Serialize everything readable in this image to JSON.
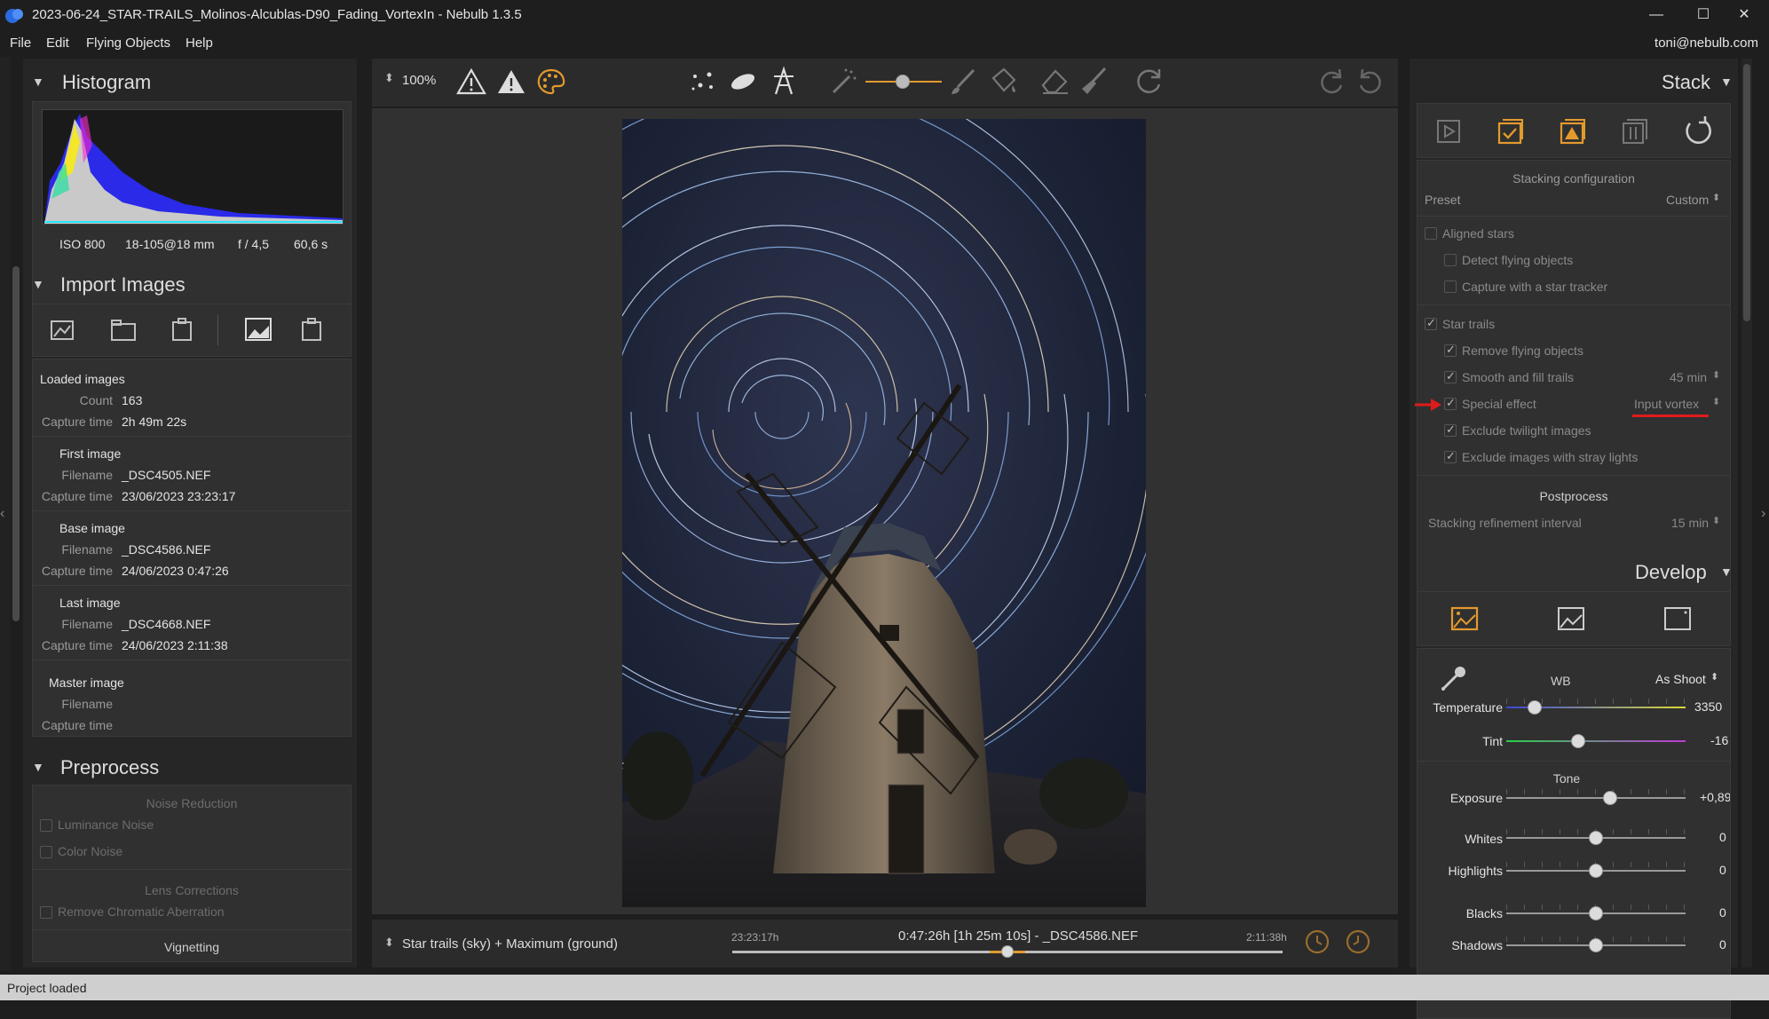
{
  "window": {
    "title": "2023-06-24_STAR-TRAILS_Molinos-Alcublas-D90_Fading_VortexIn - Nebulb 1.3.5",
    "minimize": "—",
    "maximize": "☐",
    "close": "✕"
  },
  "menu": {
    "items": [
      "File",
      "Edit",
      "Flying Objects",
      "Help"
    ],
    "user": "toni@nebulb.com"
  },
  "toolbar": {
    "zoom": "100%",
    "icons": [
      "warning-outline-icon",
      "warning-filled-icon",
      "palette-icon",
      "stars-icon",
      "comet-icon",
      "tower-icon",
      "magic-wand-icon",
      "brush-icon",
      "bucket-icon",
      "eraser-icon",
      "broom-icon",
      "refresh-icon",
      "redo-icon",
      "undo-icon"
    ],
    "accent": "#e39a2d"
  },
  "histogram": {
    "title": "Histogram",
    "iso": "ISO 800",
    "lens": "18-105@18 mm",
    "aperture": "f / 4,5",
    "exposure": "60,6 s"
  },
  "import": {
    "title": "Import Images",
    "loaded_title": "Loaded images",
    "count_label": "Count",
    "count": "163",
    "capture_label": "Capture time",
    "capture": "2h 49m 22s",
    "first": {
      "title": "First image",
      "filename_label": "Filename",
      "filename": "_DSC4505.NEF",
      "capture_label": "Capture time",
      "capture": "23/06/2023 23:23:17"
    },
    "base": {
      "title": "Base image",
      "filename_label": "Filename",
      "filename": "_DSC4586.NEF",
      "capture_label": "Capture time",
      "capture": "24/06/2023 0:47:26"
    },
    "last": {
      "title": "Last image",
      "filename_label": "Filename",
      "filename": "_DSC4668.NEF",
      "capture_label": "Capture time",
      "capture": "24/06/2023 2:11:38"
    },
    "master": {
      "title": "Master image",
      "filename_label": "Filename",
      "capture_label": "Capture time"
    }
  },
  "preprocess": {
    "title": "Preprocess",
    "noise_title": "Noise Reduction",
    "luminance": "Luminance Noise",
    "color": "Color Noise",
    "lens_title": "Lens Corrections",
    "chromatic": "Remove Chromatic Aberration",
    "vignetting": "Vignetting"
  },
  "stack": {
    "title": "Stack",
    "config_title": "Stacking configuration",
    "preset_label": "Preset",
    "preset_value": "Custom",
    "aligned_stars": "Aligned stars",
    "detect_flying": "Detect flying objects",
    "star_tracker": "Capture with a star tracker",
    "star_trails": "Star trails",
    "remove_flying": "Remove flying objects",
    "smooth_fill": "Smooth and fill trails",
    "smooth_value": "45 min",
    "special_effect": "Special effect",
    "special_value": "Input vortex",
    "exclude_twilight": "Exclude twilight images",
    "exclude_stray": "Exclude images with stray lights",
    "postprocess_title": "Postprocess",
    "refinement_label": "Stacking refinement interval",
    "refinement_value": "15 min",
    "checked": {
      "aligned_stars": false,
      "detect_flying": false,
      "star_tracker": false,
      "star_trails": true,
      "remove_flying": true,
      "smooth_fill": true,
      "special_effect": true,
      "exclude_twilight": true,
      "exclude_stray": true
    },
    "highlight_color": "#e01b1b"
  },
  "develop": {
    "title": "Develop",
    "wb_label": "WB",
    "wb_value": "As Shoot",
    "temperature_label": "Temperature",
    "temperature_value": "3350",
    "tint_label": "Tint",
    "tint_value": "-16",
    "tone_title": "Tone",
    "exposure_label": "Exposure",
    "exposure_value": "+0,89",
    "whites_label": "Whites",
    "whites_value": "0",
    "highlights_label": "Highlights",
    "highlights_value": "0",
    "blacks_label": "Blacks",
    "blacks_value": "0",
    "shadows_label": "Shadows",
    "shadows_value": "0",
    "slider_fractions": {
      "temperature": 0.16,
      "tint": 0.4,
      "exposure": 0.58,
      "whites": 0.5,
      "highlights": 0.5,
      "blacks": 0.5,
      "shadows": 0.5
    }
  },
  "timeline": {
    "mode": "Star trails (sky) + Maximum (ground)",
    "start": "23:23:17h",
    "current": "0:47:26h [1h 25m 10s] - _DSC4586.NEF",
    "end": "2:11:38h",
    "position_fraction": 0.5
  },
  "status": {
    "text": "Project loaded"
  }
}
